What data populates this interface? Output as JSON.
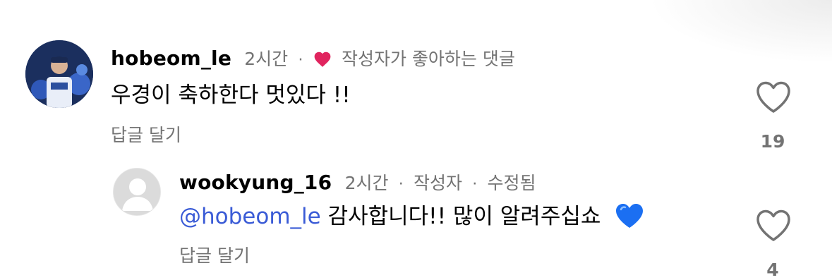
{
  "comments": [
    {
      "username": "hobeom_le",
      "time": "2시간",
      "badge": "작성자가 좋아하는 댓글",
      "text": "우경이 축하한다 멋있다 !!",
      "reply_label": "답글 달기",
      "likes": "19"
    }
  ],
  "reply": {
    "username": "wookyung_16",
    "time": "2시간",
    "author_tag": "작성자",
    "edited": "수정됨",
    "mention": "@hobeom_le",
    "text": "감사합니다!! 많이 알려주십쇼",
    "reply_label": "답글 달기",
    "likes": "4"
  },
  "separators": {
    "dot": "·"
  },
  "colors": {
    "heart_red": "#e0245e",
    "mention_blue": "#3a5bd6",
    "meta_gray": "#737373",
    "blue_heart": "#1b6ff2"
  },
  "icons": {
    "liked_by_author": "red-heart-icon",
    "like": "heart-outline-icon",
    "emoji": "blue-heart-emoji"
  }
}
